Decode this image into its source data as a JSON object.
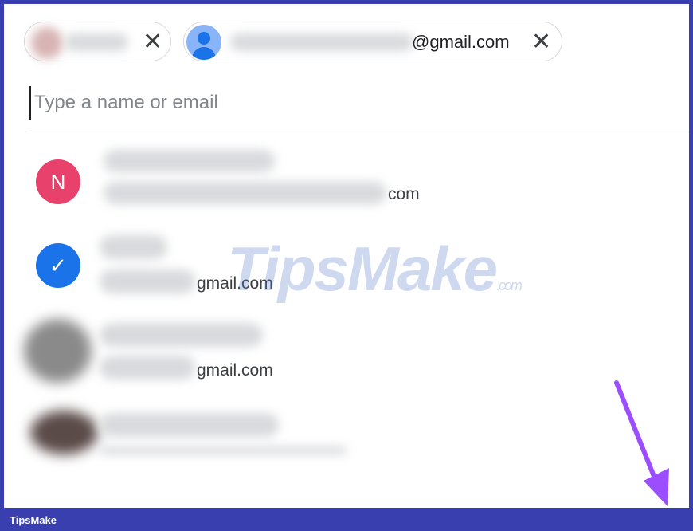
{
  "recipients": [
    {
      "email_suffix": ""
    },
    {
      "email_suffix": "@gmail.com"
    }
  ],
  "search": {
    "placeholder": "Type a name or email"
  },
  "contacts": [
    {
      "initial": "N",
      "email_tail": "com"
    },
    {
      "initial": "✓",
      "email_tail": "gmail.com"
    },
    {
      "initial": "",
      "email_tail": "gmail.com"
    },
    {
      "initial": "",
      "email_tail": ""
    }
  ],
  "icons": {
    "remove": "close-icon",
    "selected": "check-icon",
    "default_avatar": "person-icon"
  },
  "watermark": {
    "brand": "TipsMake",
    "suffix": ".com"
  },
  "footer": {
    "brand": "TipsMake"
  },
  "colors": {
    "accent": "#1a73e8",
    "frame": "#3a3fb0",
    "avatar_n": "#e8416b",
    "arrow": "#9b4dff"
  }
}
